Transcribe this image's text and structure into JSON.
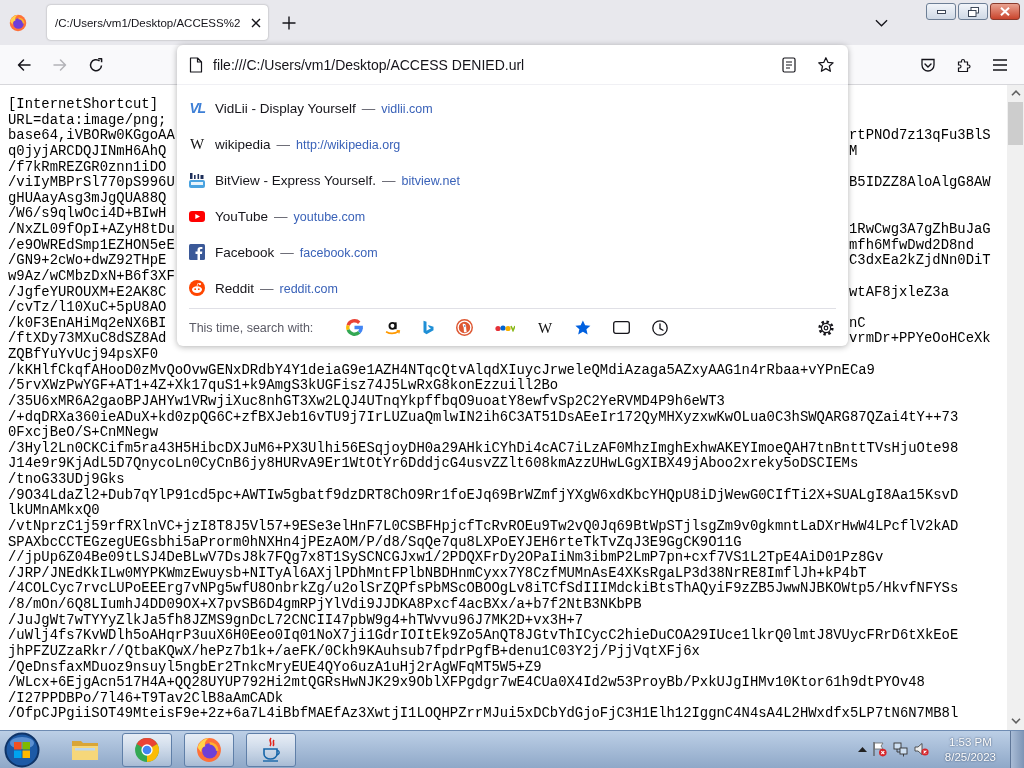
{
  "tabs": [
    {
      "title": "/C:/Users/vm1/Desktop/ACCESS%2",
      "selected": true
    }
  ],
  "nav_buttons": [
    {
      "kind": "back",
      "disabled": false
    },
    {
      "kind": "forward",
      "disabled": true
    },
    {
      "kind": "reload",
      "disabled": false
    }
  ],
  "address_bar": {
    "value": "file:///C:/Users/vm1/Desktop/ACCESS DENIED.url"
  },
  "suggestions": [
    {
      "kind": "vidlii",
      "icon_text": "VL",
      "title": "VidLii - Display Yourself",
      "separator": "—",
      "url": "vidlii.com"
    },
    {
      "kind": "wikipedia",
      "icon_text": "W",
      "title": "wikipedia",
      "separator": "—",
      "url": "http://wikipedia.org"
    },
    {
      "kind": "bitview",
      "title": "BitView - Express Yourself.",
      "separator": "—",
      "url": "bitview.net"
    },
    {
      "kind": "youtube",
      "title": "YouTube",
      "separator": "—",
      "url": "youtube.com"
    },
    {
      "kind": "facebook",
      "title": "Facebook",
      "separator": "—",
      "url": "facebook.com"
    },
    {
      "kind": "reddit",
      "title": "Reddit",
      "separator": "—",
      "url": "reddit.com"
    }
  ],
  "search_bar": {
    "label": "This time, search with:",
    "engines": [
      {
        "kind": "google"
      },
      {
        "kind": "amazon"
      },
      {
        "kind": "bing"
      },
      {
        "kind": "duckduckgo"
      },
      {
        "kind": "ebay"
      },
      {
        "kind": "wikipedia",
        "icon_text": "W"
      },
      {
        "kind": "bookmarks"
      },
      {
        "kind": "tabs"
      },
      {
        "kind": "history"
      }
    ]
  },
  "document": {
    "lines": [
      {
        "kind": "full",
        "text": "[InternetShortcut]"
      },
      {
        "kind": "covered",
        "left": "URL=data:image/png;"
      },
      {
        "kind": "covered",
        "left": "base64,iVBORw0KGgoAA",
        "right": "rtPNOd7z13qFu3BlS"
      },
      {
        "kind": "covered",
        "left": "q0jyjARCDQJINmH6AhQ",
        "right": "M"
      },
      {
        "kind": "covered",
        "left": "/f7kRmREZGR0znn1iDO"
      },
      {
        "kind": "covered",
        "left": "/viIyMBPrSl770pS996U",
        "right": "B5IDZZ8AloAlgG8AW"
      },
      {
        "kind": "covered",
        "left": "gHUAayAsg3mJgQUA88Q"
      },
      {
        "kind": "covered",
        "left": "/W6/s9qlwOci4D+BIwH"
      },
      {
        "kind": "covered",
        "left": "/NxZL09fOpI+AZyH8tDu",
        "right": "1RwCwg3A7gZhBuJaG"
      },
      {
        "kind": "covered",
        "left": "/e9OWREdSmp1EZHON5eE",
        "right": "mfh6MfwDwd2D8nd"
      },
      {
        "kind": "covered",
        "left": "/GN9+2cWo+dwZ92THpE",
        "right": "C3dxEa2kZjdNn0DiT"
      },
      {
        "kind": "covered",
        "left": "w9Az/wCMbzDxN+B6f3XF"
      },
      {
        "kind": "covered",
        "left": "/JgfeYUROUXM+E2AK8C",
        "right": "wtAF8jxleZ3a"
      },
      {
        "kind": "covered",
        "left": "/cvTz/l10XuC+5pU8AO"
      },
      {
        "kind": "covered",
        "left": "/k0F3EnAHiMq2eNX6BI",
        "right": "nC"
      },
      {
        "kind": "covered",
        "left": "/ftXDy73MXuC8dSZ8Ad",
        "right": "vrmDr+PPYeOoHCeXk"
      },
      {
        "kind": "full",
        "text": "ZQBfYuYvUcj94psXF0"
      },
      {
        "kind": "full",
        "text": "/kKHlfCkqfAHooD0zMvQoOvwGENxDRdbY4Y1deiaG9e1AZH4NTqcQtvAlqdXIuycJrweleQMdiAzaga5AZxyAAG1n4rRbaa+vYPnECa9"
      },
      {
        "kind": "full",
        "text": "/5rvXWzPwYGF+AT1+4Z+Xk17quS1+k9AmgS3kUGFisz74J5LwRxG8konEzzuill2Bo"
      },
      {
        "kind": "full",
        "text": "/35U6xMR6A2gaoBPJAHYw1VRwjiXuc8nhGT3Xw2LQJ4UTnqYkpffbqO9uoatY8ewfvSp2C2YeRVMD4P9h6eWT3"
      },
      {
        "kind": "full",
        "text": "/+dqDRXa360ieADuX+kd0zpQG6C+zfBXJeb16vTU9j7IrLUZuaQmlwIN2ih6C3AT51DsAEeIr172QyMHXyzxwKwOLua0C3hSWQARG87QZai4tY++73"
      },
      {
        "kind": "full",
        "text": "0FxcjBeO/S+CnMNegw"
      },
      {
        "kind": "full",
        "text": "/3Hyl2Ln0CKCifm5ra43H5HibcDXJuM6+PX3Ulhi56ESqjoyDH0a29AHkiCYhDi4cAC7iLzAF0MhzImghExhwAKEYImoeQAH7tnBnttTVsHjuOte98"
      },
      {
        "kind": "full",
        "text": "J14e9r9KjAdL5D7QnycoLn0CyCnB6jy8HURvA9Er1WtOtYr6DddjcG4usvZZlt608kmAzzUHwLGgXIBX49jAboo2xreky5oDSCIEMs"
      },
      {
        "kind": "full",
        "text": "/tnoG33UDj9Gks"
      },
      {
        "kind": "full",
        "text": "/9O34LdaZl2+Dub7qYlP91cd5pc+AWTIw5gbatf9dzDRT8ChO9Rr1foEJq69BrWZmfjYXgW6xdKbcYHQpU8iDjWewG0CIfTi2X+SUALgI8Aa15KsvD"
      },
      {
        "kind": "full",
        "text": "lkUMnAMkxQ0"
      },
      {
        "kind": "full",
        "text": "/vtNprzC1j59rfRXlnVC+jzI8T8J5Vl57+9ESe3elHnF7L0CSBFHpjcfTcRvROEu9Tw2vQ0Jq69BtWpSTjlsgZm9v0gkmntLaDXrHwW4LPcflV2kAD"
      },
      {
        "kind": "full",
        "text": "SPAXbcCCTEGzegUEGsbhi5aProrm0hNXHn4jPEzAOM/P/d8/SqQe7qu8LXPoEYJEH6rteTkTvZqJ3E9GgCK9O11G"
      },
      {
        "kind": "full",
        "text": "//jpUp6Z04Be09tLSJ4DeBLwV7DsJ8k7FQg7x8T1SySCNCGJxw1/2PDQXFrDy2OPaIiNm3ibmP2LmP7pn+cxf7VS1L2TpE4AiD01Pz8Gv"
      },
      {
        "kind": "full",
        "text": "/JRP/JNEdKkILw0MYPKWmzEwuysb+NITyAl6AXjlPDhMntFPlbNBDHnmCyxx7Y8CzfMUMnAsE4XKsRgaLP3d38NrRE8ImflJh+kP4bT"
      },
      {
        "kind": "full",
        "text": "/4COLCyc7rvcLUPoEEErg7vNPg5wfU8OnbrkZg/u2olSrZQPfsPbMScOBOOgLv8iTCfSdIIIMdckiBtsThAQyiF9zZB5JwwNJBKOWtp5/HkvfNFYSs"
      },
      {
        "kind": "full",
        "text": "/8/mOn/6Q8LIumhJ4DD09OX+X7pvSB6D4gmRPjYlVdi9JJDKA8Pxcf4acBXx/a+b7f2NtB3NKbPB"
      },
      {
        "kind": "full",
        "text": "/JuJgWt7wTYYyZlkJa5fh8JZMS9gnDcL72CNCII47pbW9g4+hTWvvu96J7MK2D+vx3H+7"
      },
      {
        "kind": "full",
        "text": "/uWlj4fs7KvWDlh5oAHqrP3uuX6H0Eeo0Iq01NoX7ji1GdrIOItEk9Zo5AnQT8JGtvThICycC2hieDuCOA29IUce1lkrQ0lmtJ8VUycFRrD6tXkEoE"
      },
      {
        "kind": "full",
        "text": "jhPFZUZzaRkr//QtbaKQwX/hePz7b1k+/aeFK/0Ckh9KAuhsub7fpdrPgfB+denu1C03Y2j/PjjVqtXFj6x"
      },
      {
        "kind": "full",
        "text": "/QeDnsfaxMDuoz9nsuyl5ngbEr2TnkcMryEUE4QYo6uzA1uHj2rAgWFqMT5W5+Z9"
      },
      {
        "kind": "full",
        "text": "/WLcx+6EjgAcn517H4A+QQ28UYUP792Hi2mtQGRsHwNJK29x9OblXFPgdgr7wE4CUa0X4Id2w53ProyBb/PxkUJgIHMv10Ktor61h9dtPYOv48"
      },
      {
        "kind": "full",
        "text": "/I27PPDBPo/7l46+T9Tav2ClB8aAmCADk"
      },
      {
        "kind": "full",
        "text": "/OfpCJPgiiSOT49MteisF9e+2z+6a7L4iBbfMAEfAz3XwtjI1LOQHPZrrMJui5xDCbYdGjoFjC3H1Elh12IggnC4N4sA4L2HWxdfx5LP7tN6N7MB8l"
      }
    ]
  },
  "taskbar": {
    "apps": [
      {
        "kind": "explorer",
        "running": false
      },
      {
        "kind": "chrome",
        "running": true
      },
      {
        "kind": "firefox",
        "running": true
      },
      {
        "kind": "java",
        "running": true
      }
    ],
    "tray": [
      {
        "kind": "flag"
      },
      {
        "kind": "network"
      },
      {
        "kind": "volume_muted"
      }
    ],
    "time": "1:53 PM",
    "date": "8/25/2023"
  }
}
